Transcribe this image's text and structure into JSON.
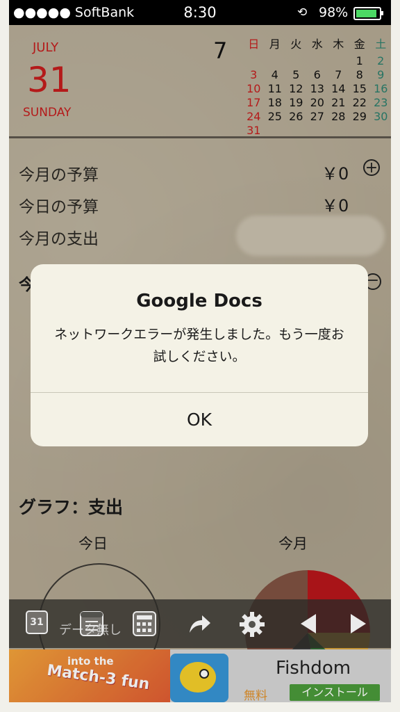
{
  "status_bar": {
    "carrier": "●●●●● SoftBank",
    "time": "8:30",
    "battery": "98%",
    "battery_level": 0.98
  },
  "date_panel": {
    "month": "JULY",
    "day": "31",
    "weekday": "SUNDAY"
  },
  "calendar": {
    "month_number": "7",
    "weekdays": [
      "日",
      "月",
      "火",
      "水",
      "木",
      "金",
      "土"
    ],
    "weeks": [
      [
        "",
        "",
        "",
        "",
        "",
        "1",
        "2"
      ],
      [
        "3",
        "4",
        "5",
        "6",
        "7",
        "8",
        "9"
      ],
      [
        "10",
        "11",
        "12",
        "13",
        "14",
        "15",
        "16"
      ],
      [
        "17",
        "18",
        "19",
        "20",
        "21",
        "22",
        "23"
      ],
      [
        "24",
        "25",
        "26",
        "27",
        "28",
        "29",
        "30"
      ],
      [
        "31",
        "",
        "",
        "",
        "",
        "",
        ""
      ]
    ]
  },
  "budget": {
    "monthly_budget_label": "今月の予算",
    "monthly_budget_value": "￥0",
    "daily_budget_label": "今日の予算",
    "daily_budget_value": "￥0",
    "monthly_spend_label": "今月の支出",
    "partial_label": "今"
  },
  "graph": {
    "title": "グラフ：支出",
    "today_label": "今日",
    "month_label": "今月",
    "no_data_text": "データ無し"
  },
  "toolbar": {
    "calendar_icon_text": "31"
  },
  "ad": {
    "headline_small": "into the",
    "headline_large": "Match-3 fun",
    "app_name": "Fishdom",
    "price": "無料",
    "install_label": "インストール"
  },
  "alert": {
    "title": "Google Docs",
    "message": "ネットワークエラーが発生しました。もう一度お試しください。",
    "ok_label": "OK"
  },
  "colors": {
    "accent_red": "#c41d1d",
    "saturday_green": "#2a7e6c",
    "paper": "#b4a993"
  },
  "chart_data": {
    "type": "pie",
    "title": "今月",
    "values": [
      25,
      12,
      10,
      15,
      38
    ],
    "colors": [
      "#b7161b",
      "#d6a43d",
      "#2f6a33",
      "#3a3a3a",
      "#7f5242"
    ]
  }
}
